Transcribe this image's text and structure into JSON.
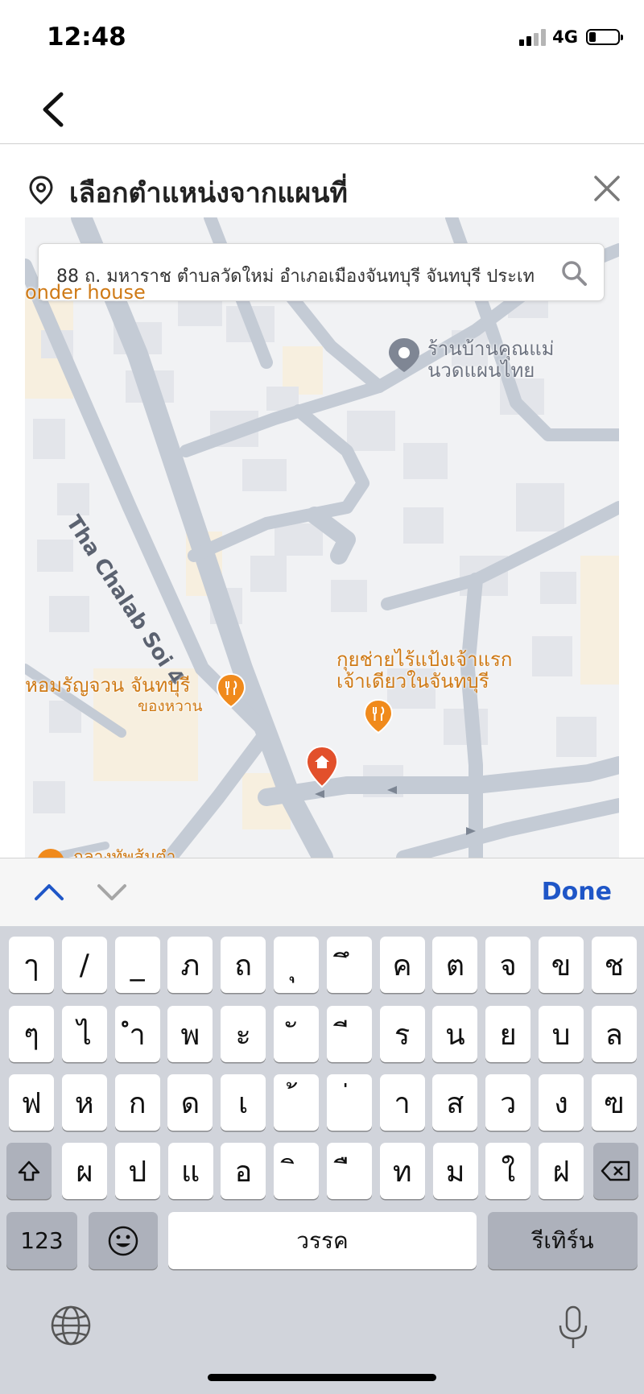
{
  "status_bar": {
    "time": "12:48",
    "network": "4G"
  },
  "panel": {
    "title": "เลือกตำแหน่งจากแผนที่"
  },
  "search": {
    "value": "88 ถ. มหาราช ตำบลวัดใหม่ อำเภอเมืองจันทบุรี จันทบุรี ประเท"
  },
  "map": {
    "pois": {
      "wonder_house": "onder house",
      "massage_line1": "ร้านบ้านคุณแม่",
      "massage_line2": "นวดแผนไทย",
      "hom_ran_juan": "หอมรัญจวน จันทบุรี",
      "hom_sub": "ของหวาน",
      "kuay_chai_line1": "กุยช่ายไร้แป้งเจ้าแรก",
      "kuay_chai_line2": "เจ้าเดียวในจันทบุรี",
      "bottom_poi": "กลางทัพส้มตำ"
    },
    "street_label": "Tha Chalab Soi 4"
  },
  "toolbar": {
    "done_label": "Done"
  },
  "keyboard": {
    "row1": [
      "ๅ",
      "/",
      "_",
      "ภ",
      "ถ",
      "ุ",
      "ึ",
      "ค",
      "ต",
      "จ",
      "ข",
      "ช"
    ],
    "row2": [
      "ๆ",
      "ไ",
      "ำ",
      "พ",
      "ะ",
      "ั",
      "ี",
      "ร",
      "น",
      "ย",
      "บ",
      "ล"
    ],
    "row3": [
      "ฟ",
      "ห",
      "ก",
      "ด",
      "เ",
      "้",
      "่",
      "า",
      "ส",
      "ว",
      "ง",
      "ฃ"
    ],
    "row4": [
      "ผ",
      "ป",
      "แ",
      "อ",
      "ิ",
      "ื",
      "ท",
      "ม",
      "ใ",
      "ฝ"
    ],
    "numbers_label": "123",
    "space_label": "วรรค",
    "return_label": "รีเทิร์น"
  },
  "colors": {
    "accent": "#1f56c7",
    "poi_orange": "#cf7a16",
    "marker_red": "#e2502b"
  }
}
